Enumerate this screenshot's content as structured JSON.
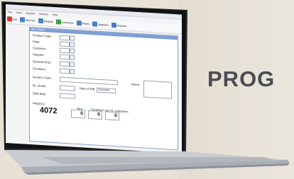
{
  "banner": {
    "text": "PROG"
  },
  "app": {
    "menu": [
      "File",
      "View",
      "Reports",
      "Window",
      "Help"
    ],
    "toolbar": [
      {
        "label": "Exit",
        "color": "#d33a2c"
      },
      {
        "label": "New Wt.",
        "color": "#4a7fc1"
      },
      {
        "label": "Weights",
        "color": "#4a7fc1"
      },
      {
        "label": "Customers",
        "color": "#3aa142"
      },
      {
        "label": "Plates",
        "color": "#4a7fc1"
      },
      {
        "label": "Suppliers",
        "color": "#4a7fc1"
      },
      {
        "label": "Reports",
        "color": "#4a7fc1"
      }
    ],
    "form": {
      "title": "New Weight",
      "labels": {
        "product_code": "Product Code:",
        "plate": "Plate:",
        "customer": "Customer:",
        "supplier": "Supplier:",
        "opened_ncd": "Opened NCD:",
        "container": "Container:",
        "generic_code": "Generic Code:",
        "nr_of_wb": "Nr. of WB:",
        "date_of_wb": "Date of WB",
        "start_date": "Start date:",
        "notes": "Notes:",
        "weight_a": "Weight A:",
        "tare": "Tare",
        "container_tare": "Container tare",
        "containers": "N. containers"
      },
      "date_value": "7/01/2009",
      "weight_a_value": "4072",
      "tare_value": "0",
      "container_tare_value": "0",
      "containers_value": "0"
    }
  }
}
